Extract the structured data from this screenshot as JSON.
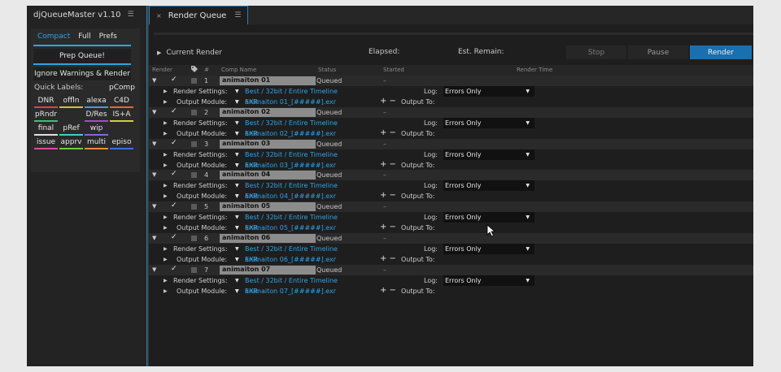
{
  "left_panel": {
    "title": "djQueueMaster v1.10",
    "menu_icon": "☰",
    "tabs": [
      "Compact",
      "Full",
      "Prefs"
    ],
    "prep_button": "Prep Queue!",
    "ignore_button": "Ignore Warnings & Render",
    "quick_labels_title": "Quick Labels:",
    "quick_labels_extra": "pComp",
    "labels": [
      {
        "text": "DNR",
        "color": "#d44a3a"
      },
      {
        "text": "offln",
        "color": "#e0b83a"
      },
      {
        "text": "alexa",
        "color": "#3aa0e0"
      },
      {
        "text": "C4D",
        "color": "#e06a3a"
      },
      {
        "text": "pRndr",
        "color": "#3ac07a"
      },
      {
        "text": "",
        "color": "#2a2a2a"
      },
      {
        "text": "D/Res",
        "color": "#a050c0"
      },
      {
        "text": "IS+A",
        "color": "#d0d040"
      },
      {
        "text": "final",
        "color": "#e0e0e0"
      },
      {
        "text": "pRef",
        "color": "#3ad0c0"
      },
      {
        "text": "wip",
        "color": "#7a6ae0"
      },
      {
        "text": "",
        "color": "#2a2a2a"
      },
      {
        "text": "issue",
        "color": "#e04a9a"
      },
      {
        "text": "apprv",
        "color": "#6ad03a"
      },
      {
        "text": "multi",
        "color": "#e0903a"
      },
      {
        "text": "episo",
        "color": "#3a70e0"
      }
    ]
  },
  "render_queue": {
    "tab_label": "Render Queue",
    "tab_close": "×",
    "tab_menu": "☰",
    "current_render_label": "Current Render",
    "elapsed_label": "Elapsed:",
    "remain_label": "Est. Remain:",
    "stop_button": "Stop",
    "pause_button": "Pause",
    "render_button": "Render",
    "columns": {
      "render": "Render",
      "num": "#",
      "comp": "Comp Name",
      "status": "Status",
      "started": "Started",
      "render_time": "Render Time"
    },
    "render_settings_label": "Render Settings:",
    "output_module_label": "Output Module:",
    "log_label": "Log:",
    "output_to_label": "Output To:",
    "items": [
      {
        "num": "1",
        "comp": "animaiton 01",
        "status": "Queued",
        "started": "–",
        "settings": "Best / 32bit / Entire Timeline",
        "module": "EXR",
        "log": "Errors Only",
        "output": "animaiton 01_[#####].exr"
      },
      {
        "num": "2",
        "comp": "animaiton 02",
        "status": "Queued",
        "started": "–",
        "settings": "Best / 32bit / Entire Timeline",
        "module": "EXR",
        "log": "Errors Only",
        "output": "animaiton 02_[#####].exr"
      },
      {
        "num": "3",
        "comp": "animaiton 03",
        "status": "Queued",
        "started": "–",
        "settings": "Best / 32bit / Entire Timeline",
        "module": "EXR",
        "log": "Errors Only",
        "output": "animaiton 03_[#####].exr"
      },
      {
        "num": "4",
        "comp": "animaiton 04",
        "status": "Queued",
        "started": "–",
        "settings": "Best / 32bit / Entire Timeline",
        "module": "EXR",
        "log": "Errors Only",
        "output": "animaiton 04_[#####].exr"
      },
      {
        "num": "5",
        "comp": "animaiton 05",
        "status": "Queued",
        "started": "–",
        "settings": "Best / 32bit / Entire Timeline",
        "module": "EXR",
        "log": "Errors Only",
        "output": "animaiton 05_[#####].exr"
      },
      {
        "num": "6",
        "comp": "animaiton 06",
        "status": "Queued",
        "started": "–",
        "settings": "Best / 32bit / Entire Timeline",
        "module": "EXR",
        "log": "Errors Only",
        "output": "animaiton 06_[#####].exr"
      },
      {
        "num": "7",
        "comp": "animaiton 07",
        "status": "Queued",
        "started": "–",
        "settings": "Best / 32bit / Entire Timeline",
        "module": "EXR",
        "log": "Errors Only",
        "output": "animaiton 07_[#####].exr"
      }
    ]
  }
}
